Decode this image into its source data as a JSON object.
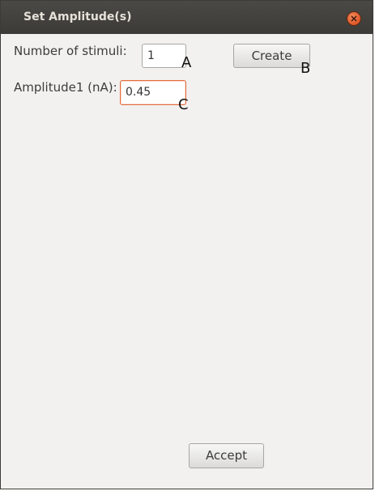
{
  "window": {
    "title": "Set Amplitude(s)",
    "close_icon": "close-icon"
  },
  "stimuli": {
    "label": "Number of stimuli:",
    "value": "1",
    "marker": "A"
  },
  "create": {
    "label": "Create",
    "marker": "B"
  },
  "amplitude": {
    "label": "Amplitude1 (nA):",
    "value": "0.45",
    "marker": "C"
  },
  "accept": {
    "label": "Accept"
  },
  "colors": {
    "titlebar": "#3c3b37",
    "close_button": "#e05a2a",
    "focus_border": "#e46b3c",
    "window_bg": "#f2f1f0"
  }
}
